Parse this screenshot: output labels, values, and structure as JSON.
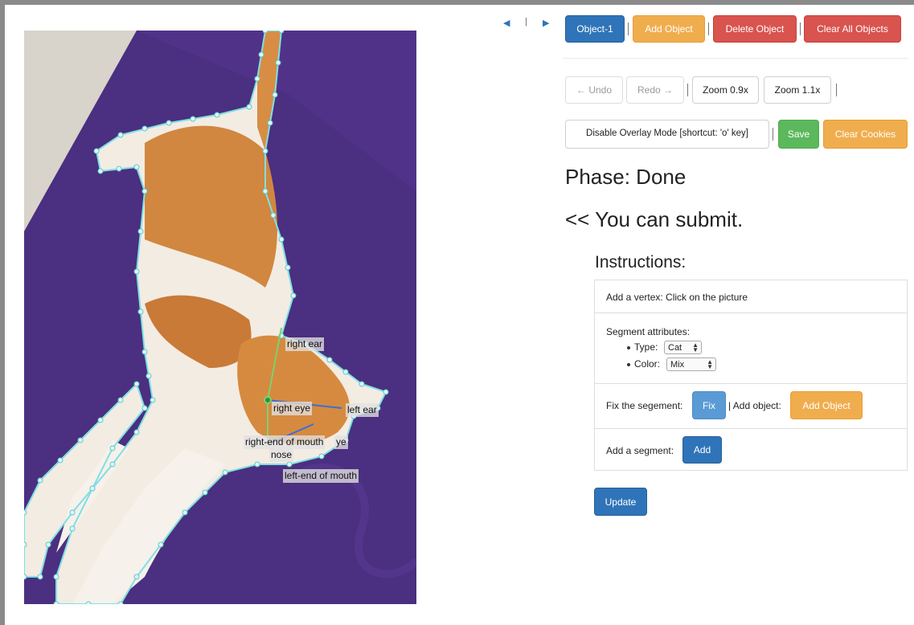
{
  "navigation": {
    "prev_icon": "triangle-left",
    "next_icon": "triangle-right",
    "divider": "|"
  },
  "toolbar": {
    "object_1": "Object-1",
    "add_object": "Add Object",
    "delete_object": "Delete Object",
    "clear_all_objects": "Clear All Objects"
  },
  "edit_bar": {
    "undo": "← Undo",
    "redo": "Redo →",
    "zoom_out": "Zoom 0.9x",
    "zoom_in": "Zoom 1.1x"
  },
  "overlay_bar": {
    "disable_overlay": "Disable Overlay Mode [shortcut: 'o' key]",
    "save": "Save",
    "clear_cookies": "Clear Cookies"
  },
  "status": {
    "phase": "Phase: Done",
    "submit_msg": "<< You can submit."
  },
  "instructions": {
    "heading": "Instructions:",
    "add_vertex": "Add a vertex: Click on the picture",
    "segment_attributes": "Segment attributes:",
    "type_label": "Type:",
    "type_value": "Cat",
    "color_label": "Color:",
    "color_value": "Mix",
    "fix_segment_label": "Fix the segement:",
    "fix_button": "Fix",
    "add_object_label": "| Add object:",
    "add_object_button": "Add Object",
    "add_segment_label": "Add a segment:",
    "add_button": "Add"
  },
  "update_button": "Update",
  "keypoints": {
    "right_ear": "right ear",
    "right_eye": "right eye",
    "left_ear": "left ear",
    "right_mouth": "right-end of mouth",
    "ye": "ye",
    "nose": "nose",
    "left_mouth": "left-end of mouth"
  },
  "colors": {
    "primary": "#2f74b8",
    "warning": "#f0ad4e",
    "danger": "#d9534f",
    "success": "#5cb85c",
    "polygon": "#6fd9dc",
    "mat": "#4a2f7e"
  }
}
